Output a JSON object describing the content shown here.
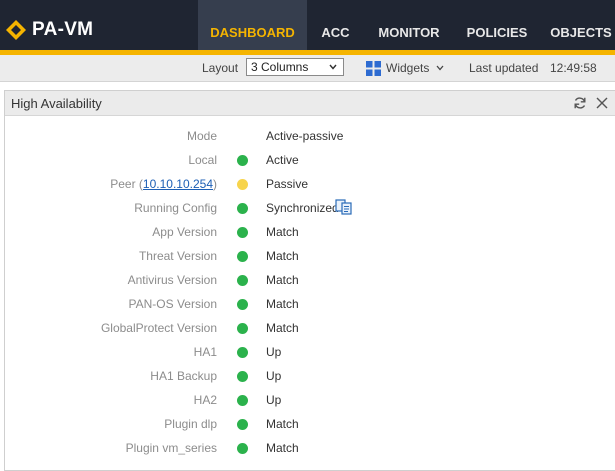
{
  "brand": {
    "name": "PA-VM"
  },
  "nav": {
    "tabs": [
      {
        "label": "DASHBOARD",
        "active": true
      },
      {
        "label": "ACC",
        "active": false
      },
      {
        "label": "MONITOR",
        "active": false
      },
      {
        "label": "POLICIES",
        "active": false
      },
      {
        "label": "OBJECTS",
        "active": false
      }
    ]
  },
  "toolbar": {
    "layout_label": "Layout",
    "layout_value": "3 Columns",
    "widgets_label": "Widgets",
    "last_updated_label": "Last updated",
    "last_updated_time": "12:49:58"
  },
  "panel": {
    "title": "High Availability",
    "rows": [
      {
        "label": "Mode",
        "value": "Active-passive",
        "status": null
      },
      {
        "label": "Local",
        "value": "Active",
        "status": "green"
      },
      {
        "label_prefix": "Peer (",
        "link": "10.10.10.254",
        "label_suffix": ")",
        "value": "Passive",
        "status": "yellow"
      },
      {
        "label": "Running Config",
        "value": "Synchronized",
        "status": "green",
        "icon": "sync-compare-icon"
      },
      {
        "label": "App Version",
        "value": "Match",
        "status": "green"
      },
      {
        "label": "Threat Version",
        "value": "Match",
        "status": "green"
      },
      {
        "label": "Antivirus Version",
        "value": "Match",
        "status": "green"
      },
      {
        "label": "PAN-OS Version",
        "value": "Match",
        "status": "green"
      },
      {
        "label": "GlobalProtect Version",
        "value": "Match",
        "status": "green"
      },
      {
        "label": "HA1",
        "value": "Up",
        "status": "green"
      },
      {
        "label": "HA1 Backup",
        "value": "Up",
        "status": "green"
      },
      {
        "label": "HA2",
        "value": "Up",
        "status": "green"
      },
      {
        "label": "Plugin dlp",
        "value": "Match",
        "status": "green"
      },
      {
        "label": "Plugin vm_series",
        "value": "Match",
        "status": "green"
      }
    ]
  },
  "colors": {
    "nav_bg": "#1f2532",
    "accent": "#f5b400",
    "status_green": "#2bb24c",
    "status_yellow": "#f7d44c",
    "link": "#1d5fb5"
  },
  "icons": [
    "logo-icon",
    "chevron-down-icon",
    "grid-icon",
    "refresh-icon",
    "close-icon",
    "sync-compare-icon"
  ]
}
